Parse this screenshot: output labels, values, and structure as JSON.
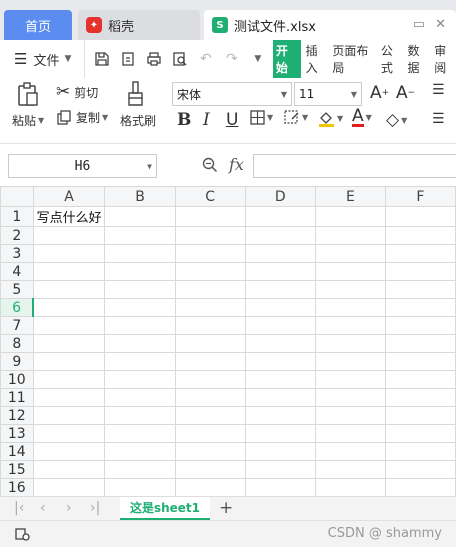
{
  "tabs": {
    "home": "首页",
    "daoke": "稻壳",
    "file": "测试文件.xlsx",
    "file_logo": "S"
  },
  "menu": {
    "file_label": "文件",
    "ribbon_tabs": [
      "开始",
      "插入",
      "页面布局",
      "公式",
      "数据",
      "审阅"
    ],
    "active_tab": "开始"
  },
  "ribbon": {
    "paste_label": "粘贴",
    "cut_label": "剪切",
    "copy_label": "复制",
    "format_painter_label": "格式刷",
    "font_name": "宋体",
    "font_size": "11"
  },
  "formula_bar": {
    "name_box": "H6",
    "fx_label": "fx"
  },
  "sheet": {
    "columns": [
      "A",
      "B",
      "C",
      "D",
      "E",
      "F"
    ],
    "rows": [
      "1",
      "2",
      "3",
      "4",
      "5",
      "6",
      "7",
      "8",
      "9",
      "10",
      "11",
      "12",
      "13",
      "14",
      "15",
      "16"
    ],
    "active_row": "6",
    "cells": {
      "A1": "写点什么好"
    }
  },
  "sheet_tabs": {
    "active": "这是sheet1",
    "add": "+"
  },
  "status": {
    "watermark": "CSDN @ shammy"
  },
  "colors": {
    "accent": "#1fae73",
    "home_tab": "#5b8cf0",
    "daoke_logo": "#e5322d"
  }
}
